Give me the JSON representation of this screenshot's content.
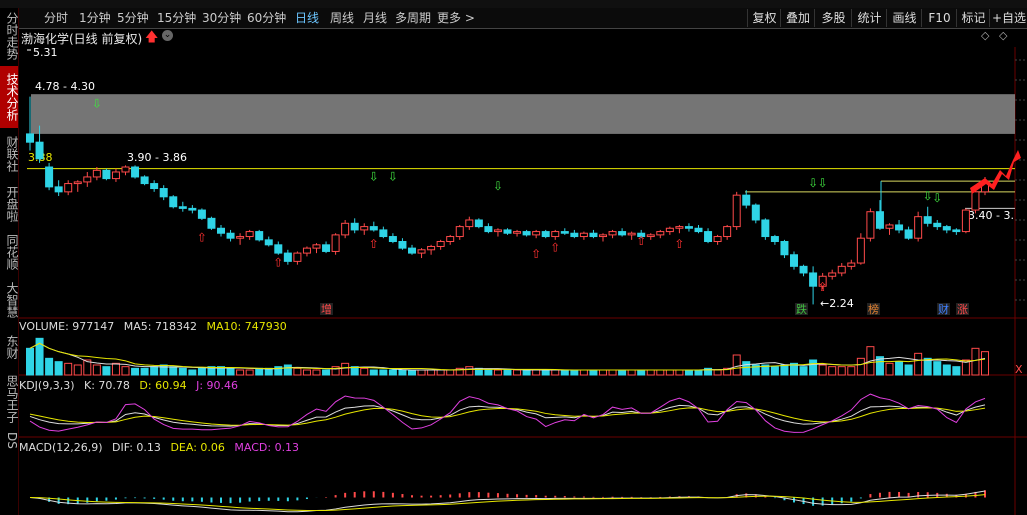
{
  "sidebar": {
    "tabs": [
      {
        "label": "分时走势",
        "active": false
      },
      {
        "label": "技术分析",
        "active": true
      },
      {
        "label": "财联社",
        "active": false
      },
      {
        "label": "开盘啦",
        "active": false
      },
      {
        "label": "同花顺",
        "active": false
      },
      {
        "label": "大智慧",
        "active": false
      },
      {
        "label": "东财",
        "active": false
      },
      {
        "label": "思马王子",
        "active": false
      },
      {
        "label": "DS",
        "active": false
      }
    ]
  },
  "toolbar": {
    "periods": [
      "分时",
      "1分钟",
      "5分钟",
      "15分钟",
      "30分钟",
      "60分钟",
      "日线",
      "周线",
      "月线",
      "多周期",
      "更多 >"
    ],
    "active_period": "日线",
    "tools": [
      "复权",
      "叠加",
      "多股",
      "统计",
      "画线",
      "F10",
      "标记",
      "+自选"
    ]
  },
  "stock": {
    "title": "渤海化学(日线 前复权)",
    "max_price": "5.31",
    "zone_label": "4.78 - 4.30",
    "left_price": "3.88",
    "line_label": "3.90 - 3.86",
    "low_price": "2.24",
    "right_label": "3.40 - 3.",
    "markers": [
      "增",
      "跌",
      "榜",
      "财",
      "涨"
    ]
  },
  "volume": {
    "label": "VOLUME: 977147",
    "ma5": "MA5: 718342",
    "ma10": "MA10: 747930"
  },
  "kdj": {
    "label": "KDJ(9,3,3)",
    "k": "K: 70.78",
    "d": "D: 60.94",
    "j": "J: 90.46"
  },
  "macd": {
    "label": "MACD(12,26,9)",
    "dif": "DIF: 0.13",
    "dea": "DEA: 0.06",
    "macd": "MACD: 0.13"
  },
  "colors": {
    "up": "#ff4a4a",
    "down": "#2fd4e6",
    "yellow": "#e6e600",
    "magenta": "#e040e0",
    "white": "#ffffff",
    "zone": "#8a8a8a"
  },
  "chart_data": {
    "type": "candlestick",
    "price_range": [
      2.1,
      5.35
    ],
    "candles": [
      [
        4.3,
        4.75,
        4.1,
        4.2
      ],
      [
        4.2,
        4.4,
        3.95,
        4.0
      ],
      [
        3.9,
        3.95,
        3.62,
        3.66
      ],
      [
        3.66,
        3.74,
        3.55,
        3.6
      ],
      [
        3.6,
        3.74,
        3.56,
        3.7
      ],
      [
        3.7,
        3.74,
        3.6,
        3.72
      ],
      [
        3.72,
        3.84,
        3.66,
        3.78
      ],
      [
        3.78,
        3.9,
        3.74,
        3.86
      ],
      [
        3.86,
        3.88,
        3.74,
        3.76
      ],
      [
        3.76,
        3.88,
        3.72,
        3.84
      ],
      [
        3.84,
        3.92,
        3.8,
        3.9
      ],
      [
        3.9,
        3.92,
        3.76,
        3.78
      ],
      [
        3.78,
        3.8,
        3.68,
        3.7
      ],
      [
        3.7,
        3.74,
        3.6,
        3.64
      ],
      [
        3.64,
        3.68,
        3.5,
        3.54
      ],
      [
        3.54,
        3.56,
        3.4,
        3.42
      ],
      [
        3.42,
        3.48,
        3.36,
        3.4
      ],
      [
        3.4,
        3.44,
        3.34,
        3.38
      ],
      [
        3.38,
        3.4,
        3.26,
        3.28
      ],
      [
        3.28,
        3.3,
        3.14,
        3.16
      ],
      [
        3.16,
        3.2,
        3.06,
        3.1
      ],
      [
        3.1,
        3.14,
        3.0,
        3.04
      ],
      [
        3.04,
        3.1,
        2.96,
        3.06
      ],
      [
        3.06,
        3.14,
        3.02,
        3.12
      ],
      [
        3.12,
        3.14,
        3.0,
        3.02
      ],
      [
        3.02,
        3.06,
        2.94,
        2.96
      ],
      [
        2.96,
        3.0,
        2.84,
        2.86
      ],
      [
        2.86,
        2.9,
        2.72,
        2.76
      ],
      [
        2.76,
        2.88,
        2.72,
        2.86
      ],
      [
        2.86,
        2.94,
        2.82,
        2.92
      ],
      [
        2.92,
        2.98,
        2.86,
        2.96
      ],
      [
        2.96,
        3.0,
        2.86,
        2.88
      ],
      [
        2.88,
        3.1,
        2.84,
        3.08
      ],
      [
        3.08,
        3.26,
        3.04,
        3.22
      ],
      [
        3.22,
        3.28,
        3.1,
        3.14
      ],
      [
        3.14,
        3.22,
        3.08,
        3.18
      ],
      [
        3.18,
        3.24,
        3.12,
        3.14
      ],
      [
        3.14,
        3.18,
        3.04,
        3.06
      ],
      [
        3.06,
        3.1,
        2.98,
        3.0
      ],
      [
        3.0,
        3.04,
        2.9,
        2.92
      ],
      [
        2.92,
        2.96,
        2.84,
        2.86
      ],
      [
        2.86,
        2.92,
        2.8,
        2.9
      ],
      [
        2.9,
        2.96,
        2.84,
        2.94
      ],
      [
        2.94,
        3.02,
        2.9,
        3.0
      ],
      [
        3.0,
        3.08,
        2.96,
        3.06
      ],
      [
        3.06,
        3.2,
        3.02,
        3.18
      ],
      [
        3.18,
        3.3,
        3.14,
        3.26
      ],
      [
        3.26,
        3.28,
        3.16,
        3.18
      ],
      [
        3.18,
        3.22,
        3.1,
        3.12
      ],
      [
        3.12,
        3.16,
        3.06,
        3.14
      ],
      [
        3.14,
        3.16,
        3.08,
        3.1
      ],
      [
        3.1,
        3.14,
        3.06,
        3.12
      ],
      [
        3.12,
        3.14,
        3.06,
        3.08
      ],
      [
        3.08,
        3.14,
        3.04,
        3.12
      ],
      [
        3.12,
        3.14,
        3.04,
        3.06
      ],
      [
        3.06,
        3.14,
        3.02,
        3.12
      ],
      [
        3.12,
        3.16,
        3.08,
        3.1
      ],
      [
        3.1,
        3.14,
        3.04,
        3.06
      ],
      [
        3.06,
        3.12,
        3.02,
        3.1
      ],
      [
        3.1,
        3.14,
        3.04,
        3.06
      ],
      [
        3.06,
        3.1,
        3.0,
        3.08
      ],
      [
        3.08,
        3.14,
        3.04,
        3.12
      ],
      [
        3.12,
        3.16,
        3.06,
        3.08
      ],
      [
        3.08,
        3.12,
        3.02,
        3.1
      ],
      [
        3.1,
        3.14,
        3.04,
        3.06
      ],
      [
        3.06,
        3.1,
        3.02,
        3.08
      ],
      [
        3.08,
        3.14,
        3.04,
        3.12
      ],
      [
        3.12,
        3.18,
        3.08,
        3.16
      ],
      [
        3.16,
        3.2,
        3.1,
        3.18
      ],
      [
        3.18,
        3.22,
        3.12,
        3.16
      ],
      [
        3.16,
        3.2,
        3.1,
        3.12
      ],
      [
        3.12,
        3.16,
        2.98,
        3.0
      ],
      [
        3.0,
        3.08,
        2.96,
        3.06
      ],
      [
        3.06,
        3.2,
        3.02,
        3.18
      ],
      [
        3.18,
        3.6,
        3.14,
        3.56
      ],
      [
        3.56,
        3.62,
        3.4,
        3.44
      ],
      [
        3.44,
        3.46,
        3.22,
        3.26
      ],
      [
        3.26,
        3.28,
        3.02,
        3.06
      ],
      [
        3.06,
        3.08,
        2.96,
        3.0
      ],
      [
        3.0,
        3.02,
        2.8,
        2.84
      ],
      [
        2.84,
        2.88,
        2.66,
        2.7
      ],
      [
        2.7,
        2.72,
        2.58,
        2.62
      ],
      [
        2.62,
        2.7,
        2.24,
        2.46
      ],
      [
        2.46,
        2.62,
        2.42,
        2.58
      ],
      [
        2.58,
        2.66,
        2.54,
        2.62
      ],
      [
        2.62,
        2.74,
        2.58,
        2.7
      ],
      [
        2.7,
        2.78,
        2.66,
        2.74
      ],
      [
        2.74,
        3.1,
        2.72,
        3.04
      ],
      [
        3.04,
        3.4,
        3.0,
        3.36
      ],
      [
        3.36,
        3.5,
        3.14,
        3.16
      ],
      [
        3.16,
        3.22,
        3.08,
        3.2
      ],
      [
        3.2,
        3.26,
        3.1,
        3.14
      ],
      [
        3.14,
        3.18,
        3.02,
        3.04
      ],
      [
        3.04,
        3.36,
        3.0,
        3.3
      ],
      [
        3.3,
        3.42,
        3.18,
        3.22
      ],
      [
        3.22,
        3.26,
        3.14,
        3.18
      ],
      [
        3.18,
        3.2,
        3.1,
        3.14
      ],
      [
        3.14,
        3.16,
        3.08,
        3.12
      ],
      [
        3.12,
        3.4,
        3.1,
        3.38
      ],
      [
        3.38,
        3.66,
        3.34,
        3.6
      ],
      [
        3.6,
        3.78,
        3.56,
        3.72
      ]
    ],
    "volume": [
      1.6,
      2.2,
      1.0,
      0.8,
      0.7,
      0.6,
      0.9,
      0.6,
      0.5,
      0.7,
      0.5,
      0.4,
      0.4,
      0.5,
      0.6,
      0.5,
      0.4,
      0.3,
      0.4,
      0.5,
      0.5,
      0.4,
      0.3,
      0.3,
      0.4,
      0.4,
      0.5,
      0.6,
      0.4,
      0.3,
      0.3,
      0.3,
      0.5,
      0.7,
      0.5,
      0.4,
      0.3,
      0.3,
      0.3,
      0.3,
      0.3,
      0.3,
      0.3,
      0.3,
      0.3,
      0.4,
      0.5,
      0.4,
      0.3,
      0.3,
      0.3,
      0.3,
      0.3,
      0.3,
      0.3,
      0.3,
      0.3,
      0.3,
      0.3,
      0.3,
      0.3,
      0.3,
      0.3,
      0.3,
      0.3,
      0.3,
      0.3,
      0.3,
      0.3,
      0.3,
      0.3,
      0.4,
      0.3,
      0.4,
      1.2,
      0.8,
      0.6,
      0.6,
      0.5,
      0.6,
      0.7,
      0.5,
      0.9,
      0.6,
      0.5,
      0.5,
      0.5,
      1.0,
      1.7,
      1.1,
      0.7,
      0.8,
      0.6,
      1.3,
      1.0,
      0.8,
      0.6,
      0.5,
      0.9,
      1.6,
      1.4
    ]
  }
}
